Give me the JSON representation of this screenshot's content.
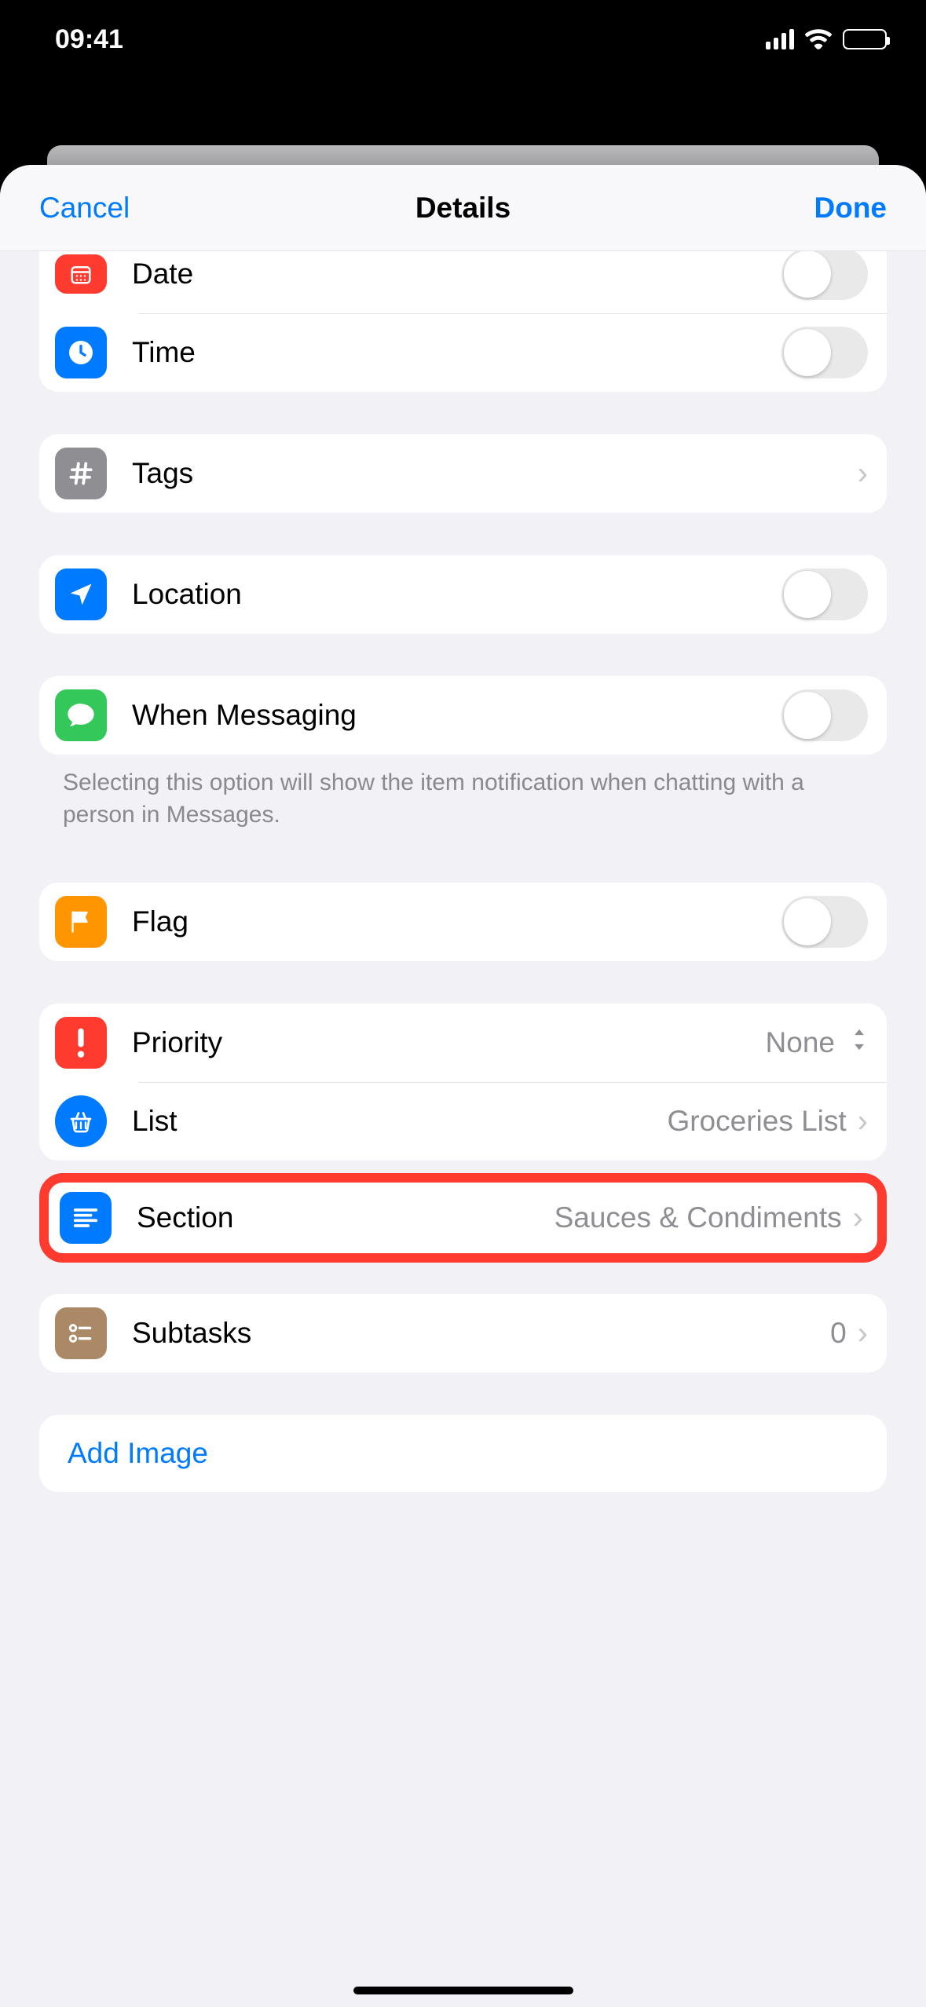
{
  "statusBar": {
    "time": "09:41"
  },
  "nav": {
    "left": "Cancel",
    "title": "Details",
    "right": "Done"
  },
  "rows": {
    "date": "Date",
    "time": "Time",
    "tags": "Tags",
    "location": "Location",
    "messaging": "When Messaging",
    "flag": "Flag",
    "priority": "Priority",
    "priorityValue": "None",
    "list": "List",
    "listValue": "Groceries List",
    "section": "Section",
    "sectionValue": "Sauces & Condiments",
    "subtasks": "Subtasks",
    "subtasksValue": "0",
    "addImage": "Add Image"
  },
  "footer": "Selecting this option will show the item notification when chatting with a person in Messages."
}
